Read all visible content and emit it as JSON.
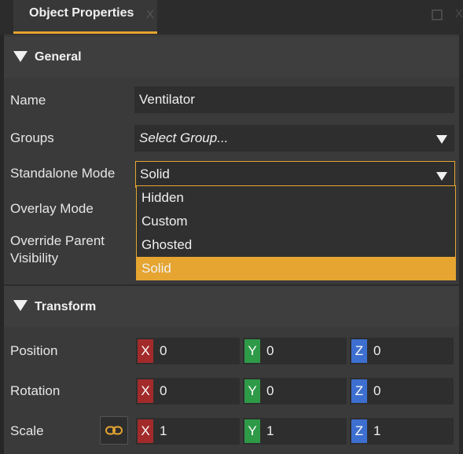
{
  "window": {
    "tab_title": "Object Properties",
    "tab_close": "X",
    "close_glyph": "X"
  },
  "colors": {
    "accent": "#e5a530",
    "axis_x": "#a32a2a",
    "axis_y": "#2e9a48",
    "axis_z": "#3d6fd1"
  },
  "general": {
    "header": "General",
    "name": {
      "label": "Name",
      "value": "Ventilator"
    },
    "groups": {
      "label": "Groups",
      "placeholder": "Select Group..."
    },
    "standalone_mode": {
      "label": "Standalone Mode",
      "value": "Solid",
      "options": [
        "Hidden",
        "Custom",
        "Ghosted",
        "Solid"
      ],
      "selected_index": 3
    },
    "overlay_mode": {
      "label": "Overlay Mode"
    },
    "override_parent_visibility": {
      "label_line1": "Override Parent",
      "label_line2": "Visibility"
    }
  },
  "transform": {
    "header": "Transform",
    "position": {
      "label": "Position",
      "x_label": "X",
      "y_label": "Y",
      "z_label": "Z",
      "x": "0",
      "y": "0",
      "z": "0"
    },
    "rotation": {
      "label": "Rotation",
      "x_label": "X",
      "y_label": "Y",
      "z_label": "Z",
      "x": "0",
      "y": "0",
      "z": "0"
    },
    "scale": {
      "label": "Scale",
      "x_label": "X",
      "y_label": "Y",
      "z_label": "Z",
      "x": "1",
      "y": "1",
      "z": "1",
      "link_icon": "link-icon"
    }
  }
}
